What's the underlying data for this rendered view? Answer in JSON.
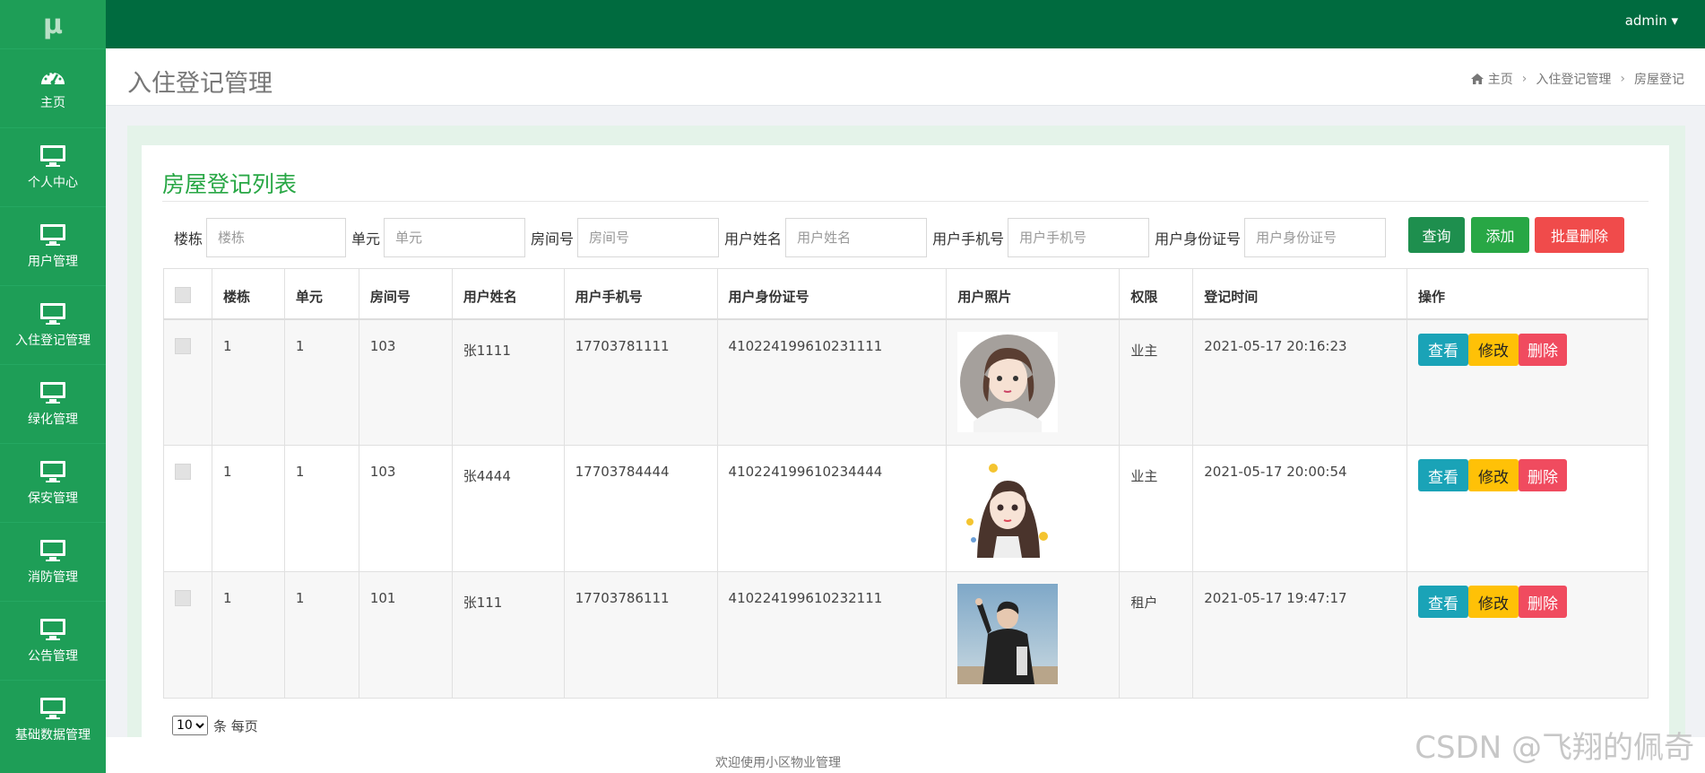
{
  "app": {
    "logo": "μ",
    "user": "admin ▾"
  },
  "sidebar": {
    "items": [
      {
        "label": "主页",
        "icon": "dashboard-icon"
      },
      {
        "label": "个人中心",
        "icon": "monitor-icon"
      },
      {
        "label": "用户管理",
        "icon": "monitor-icon"
      },
      {
        "label": "入住登记管理",
        "icon": "monitor-icon"
      },
      {
        "label": "绿化管理",
        "icon": "monitor-icon"
      },
      {
        "label": "保安管理",
        "icon": "monitor-icon"
      },
      {
        "label": "消防管理",
        "icon": "monitor-icon"
      },
      {
        "label": "公告管理",
        "icon": "monitor-icon"
      },
      {
        "label": "基础数据管理",
        "icon": "monitor-icon"
      }
    ]
  },
  "page": {
    "title": "入住登记管理",
    "breadcrumb": [
      "主页",
      "入住登记管理",
      "房屋登记"
    ]
  },
  "card": {
    "title": "房屋登记列表"
  },
  "search": {
    "fields": [
      {
        "label": "楼栋",
        "placeholder": "楼栋"
      },
      {
        "label": "单元",
        "placeholder": "单元"
      },
      {
        "label": "房间号",
        "placeholder": "房间号"
      },
      {
        "label": "用户姓名",
        "placeholder": "用户姓名"
      },
      {
        "label": "用户手机号",
        "placeholder": "用户手机号"
      },
      {
        "label": "用户身份证号",
        "placeholder": "用户身份证号"
      }
    ],
    "query_label": "查询",
    "add_label": "添加",
    "batch_delete_label": "批量删除"
  },
  "table": {
    "columns": [
      "楼栋",
      "单元",
      "房间号",
      "用户姓名",
      "用户手机号",
      "用户身份证号",
      "用户照片",
      "权限",
      "登记时间",
      "操作"
    ],
    "rows": [
      {
        "building": "1",
        "unit": "1",
        "room": "103",
        "name": "张1111",
        "phone": "17703781111",
        "id_number": "410224199610231111",
        "role": "业主",
        "time": "2021-05-17 20:16:23"
      },
      {
        "building": "1",
        "unit": "1",
        "room": "103",
        "name": "张4444",
        "phone": "17703784444",
        "id_number": "410224199610234444",
        "role": "业主",
        "time": "2021-05-17 20:00:54"
      },
      {
        "building": "1",
        "unit": "1",
        "room": "101",
        "name": "张111",
        "phone": "17703786111",
        "id_number": "410224199610232111",
        "role": "租户",
        "time": "2021-05-17 19:47:17"
      }
    ],
    "actions": {
      "view": "查看",
      "edit": "修改",
      "delete": "删除"
    }
  },
  "pager": {
    "page_size": "10",
    "suffix": "条 每页"
  },
  "footer": {
    "text": "欢迎使用小区物业管理"
  },
  "watermark": "CSDN @飞翔的佩奇",
  "colors": {
    "sidebar": "#1e9e57",
    "topbar": "#006b3f",
    "accent": "#28a745"
  }
}
